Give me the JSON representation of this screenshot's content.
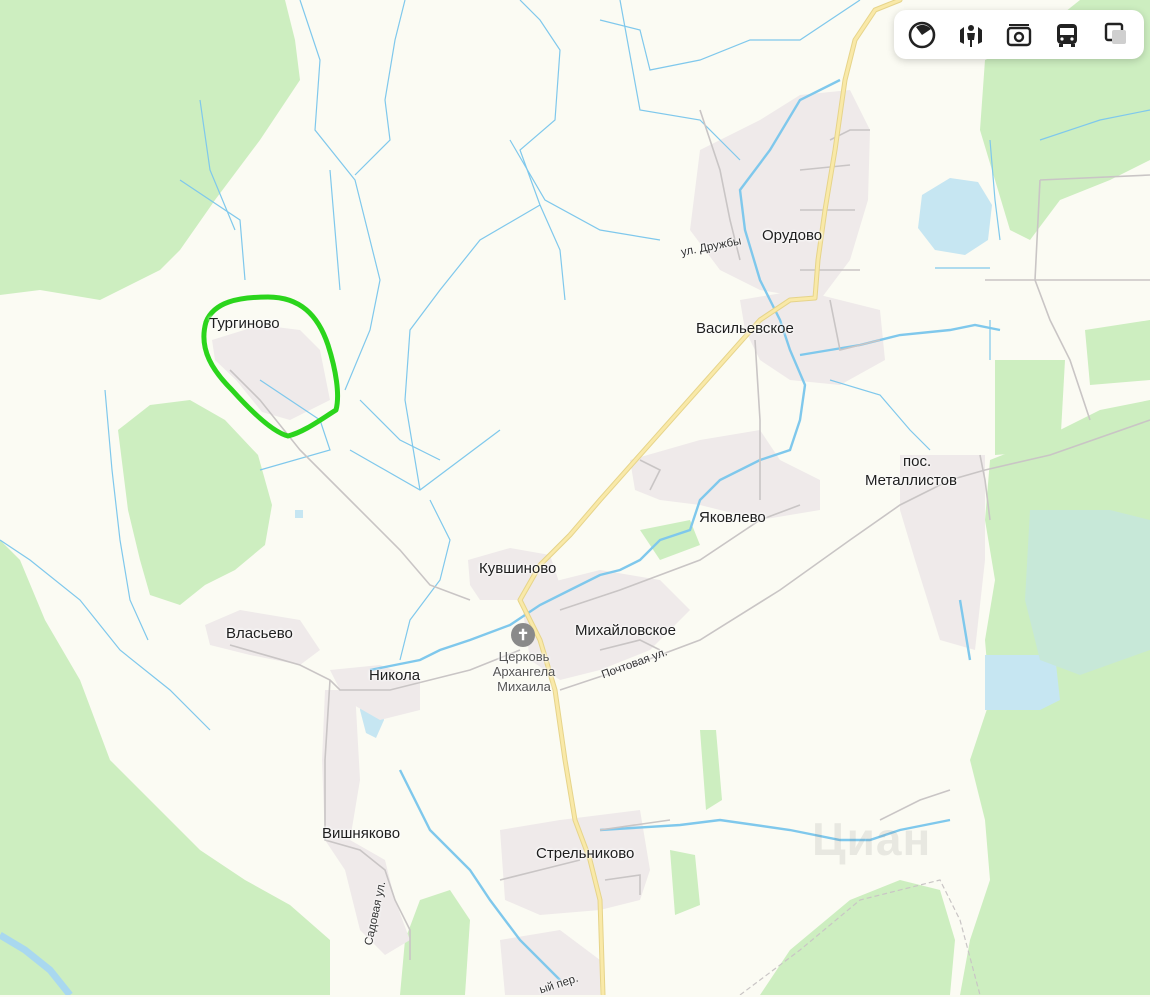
{
  "map": {
    "places": {
      "turginovo": "Тургиново",
      "orudovo": "Орудово",
      "vasilevskoe": "Васильевское",
      "pos_metallistov_1": "пос.",
      "pos_metallistov_2": "Металлистов",
      "yakovlevo": "Яковлево",
      "kuvshinovo": "Кувшиново",
      "mikhaylovskoe": "Михайловское",
      "vlasevo": "Власьево",
      "nikola": "Никола",
      "vishnyakovo": "Вишняково",
      "strelnikovo": "Стрельниково"
    },
    "streets": {
      "druzhby": "ул. Дружбы",
      "pochtovaya": "Почтовая ул.",
      "sadovaya": "Садовая ул.",
      "per_fragment": "ый пер."
    },
    "poi": {
      "church_line1": "Церковь",
      "church_line2": "Архангела",
      "church_line3": "Михаила"
    },
    "watermark": "Циан",
    "colors": {
      "background": "#fbfbf3",
      "forest": "#cdeec0",
      "water": "#c6e6f2",
      "river": "#7fc8ec",
      "road_main": "#f8e49a",
      "road_minor": "#c9c5c5",
      "settlement": "#efeaea",
      "highlight": "#2bd51c"
    }
  },
  "toolbar": {
    "buttons": [
      {
        "name": "layers",
        "icon": "layers-icon"
      },
      {
        "name": "panorama",
        "icon": "panorama-person-icon"
      },
      {
        "name": "photos",
        "icon": "camera-icon"
      },
      {
        "name": "transport",
        "icon": "bus-icon"
      },
      {
        "name": "traffic",
        "icon": "traffic-square-icon"
      }
    ]
  }
}
